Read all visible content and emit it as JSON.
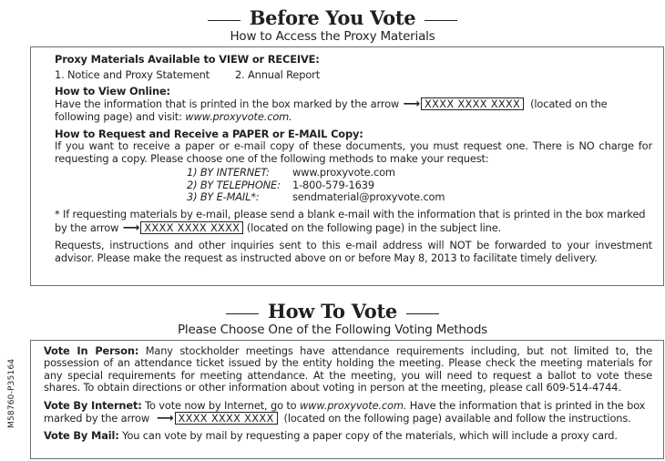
{
  "before_you_vote": {
    "title": "Before You Vote",
    "subtitle": "How to Access the Proxy Materials",
    "materials_heading": "Proxy Materials Available to VIEW or RECEIVE:",
    "materials": [
      "1. Notice and Proxy Statement",
      "2. Annual Report"
    ],
    "view_online_heading": "How to View Online:",
    "view_online_text_1": "Have the information that is printed in the box marked by the arrow",
    "view_online_text_2": "(located on the following page) and visit:",
    "view_online_url": "www.proxyvote.com.",
    "request_heading": "How to Request and Receive a PAPER or E-MAIL Copy:",
    "request_text": "If you want to receive a paper or e-mail copy of these documents, you must request one.  There is NO charge for requesting a copy.  Please choose one of the following methods to make your request:",
    "methods": [
      {
        "label": "1) BY INTERNET:",
        "value": "www.proxyvote.com"
      },
      {
        "label": "2) BY TELEPHONE:",
        "value": "1-800-579-1639"
      },
      {
        "label": "3) BY E-MAIL*:",
        "value": "sendmaterial@proxyvote.com"
      }
    ],
    "email_note_1": "*  If requesting materials by e-mail, please send a blank e-mail with the information that is printed in the box marked by the arrow",
    "email_note_2": "(located on the following page) in the subject line.",
    "disclaimer": "Requests, instructions and other inquiries sent to this e-mail address will NOT be forwarded to your investment advisor.  Please make the request as instructed above on or before May 8, 2013 to facilitate timely delivery."
  },
  "code_placeholder": "XXXX XXXX XXXX",
  "arrow_glyph": "⟶",
  "how_to_vote": {
    "title": "How To Vote",
    "subtitle": "Please Choose One of the Following Voting Methods",
    "in_person_label": "Vote In Person:",
    "in_person_text": "Many stockholder meetings have attendance requirements including, but not limited to, the possession of an attendance ticket issued by the entity holding the meeting. Please check the meeting materials for any special requirements for meeting attendance. At the meeting, you will need to request a ballot to vote these shares. To obtain directions or other information about voting in person at the meeting, please call 609-514-4744.",
    "internet_label": "Vote By Internet:",
    "internet_text_1": "To vote now by Internet, go to",
    "internet_url": "www.proxyvote.com.",
    "internet_text_2": "Have the information that is printed in the box marked by the arrow",
    "internet_text_3": "(located on the following page) available and follow the instructions.",
    "mail_label": "Vote By Mail:",
    "mail_text": "You can vote by mail by requesting a paper copy of the materials, which will include a proxy card."
  },
  "side_code": "M58760-P35164"
}
